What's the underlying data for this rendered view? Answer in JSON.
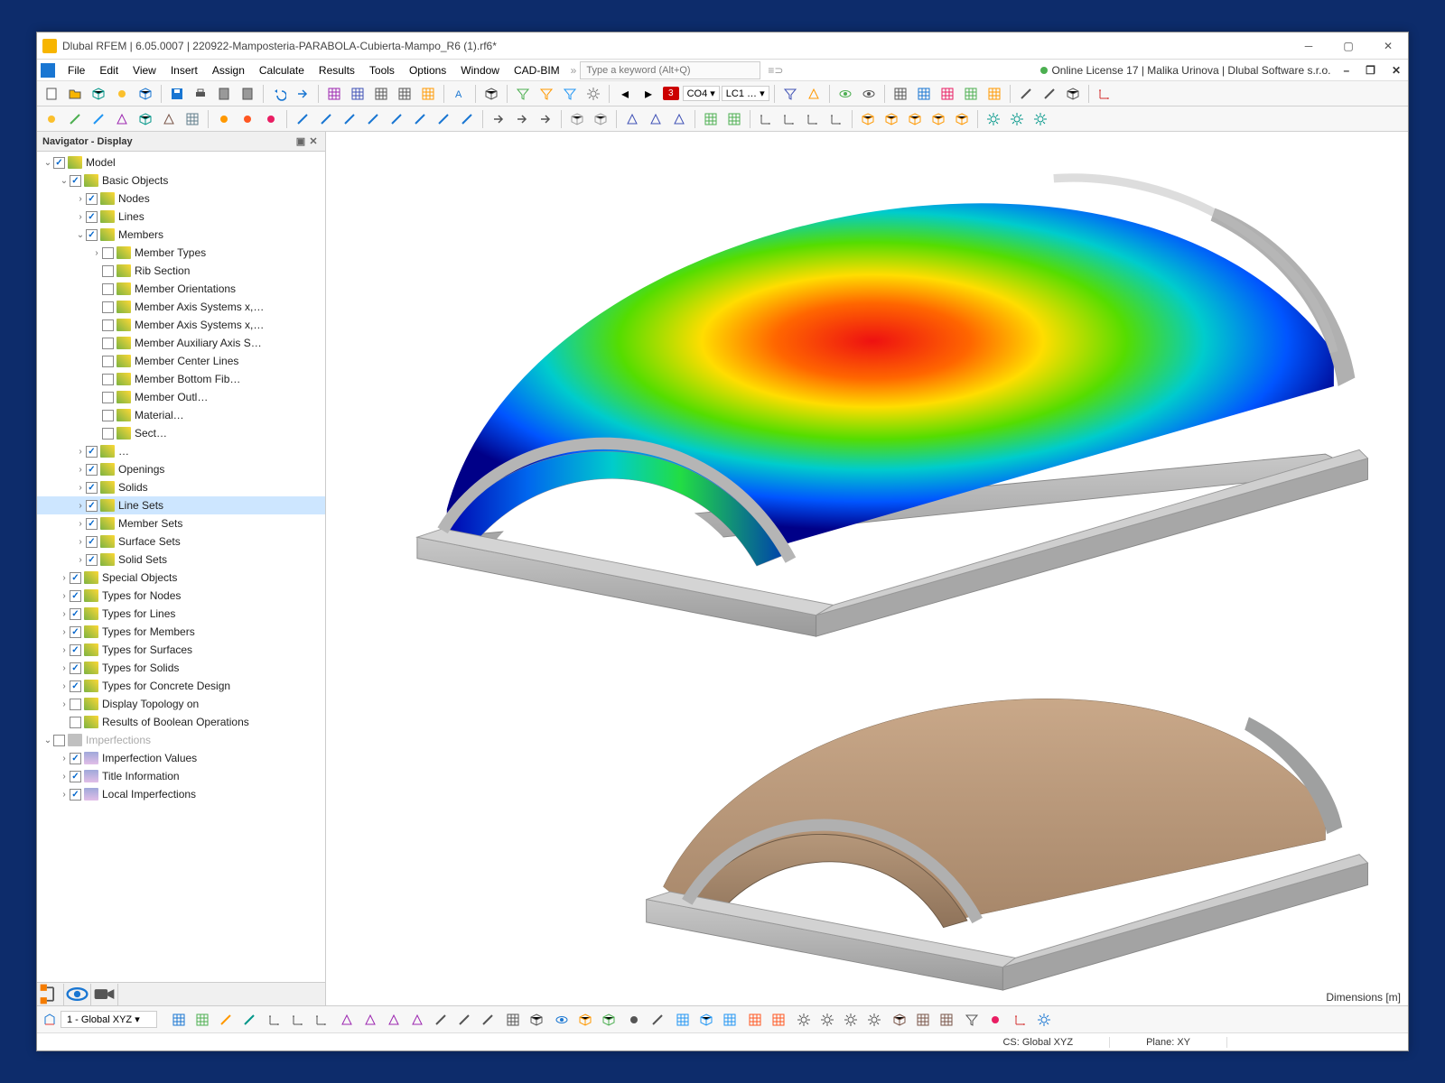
{
  "window": {
    "title": "Dlubal RFEM | 6.05.0007 | 220922-Mamposteria-PARABOLA-Cubierta-Mampo_R6 (1).rf6*"
  },
  "menu": {
    "items": [
      "File",
      "Edit",
      "View",
      "Insert",
      "Assign",
      "Calculate",
      "Results",
      "Tools",
      "Options",
      "Window",
      "CAD-BIM"
    ],
    "more": "»",
    "search_placeholder": "Type a keyword (Alt+Q)",
    "license": "Online License 17 | Malika Urinova | Dlubal Software s.r.o."
  },
  "toolbar_top": {
    "co_number": "3",
    "co_label": "CO4",
    "lc_label": "LC1 …",
    "dd": "▾"
  },
  "navigator": {
    "title": "Navigator - Display",
    "tabs_icons": [
      "tree",
      "eye",
      "camera"
    ],
    "rows": [
      {
        "d": 0,
        "tw": "v",
        "chk": true,
        "label": "Model"
      },
      {
        "d": 1,
        "tw": "v",
        "chk": true,
        "label": "Basic Objects"
      },
      {
        "d": 2,
        "tw": ">",
        "chk": true,
        "label": "Nodes"
      },
      {
        "d": 2,
        "tw": ">",
        "chk": true,
        "label": "Lines"
      },
      {
        "d": 2,
        "tw": "v",
        "chk": true,
        "label": "Members"
      },
      {
        "d": 3,
        "tw": ">",
        "chk": false,
        "label": "Member Types"
      },
      {
        "d": 3,
        "tw": "",
        "chk": false,
        "label": "Rib Section"
      },
      {
        "d": 3,
        "tw": "",
        "chk": false,
        "label": "Member Orientations"
      },
      {
        "d": 3,
        "tw": "",
        "chk": false,
        "label": "Member Axis Systems x,…"
      },
      {
        "d": 3,
        "tw": "",
        "chk": false,
        "label": "Member Axis Systems x,…"
      },
      {
        "d": 3,
        "tw": "",
        "chk": false,
        "label": "Member Auxiliary Axis S…"
      },
      {
        "d": 3,
        "tw": "",
        "chk": false,
        "label": "Member Center Lines"
      },
      {
        "d": 3,
        "tw": "",
        "chk": false,
        "label": "Member Bottom Fib…"
      },
      {
        "d": 3,
        "tw": "",
        "chk": false,
        "label": "Member Outl…"
      },
      {
        "d": 3,
        "tw": "",
        "chk": false,
        "label": "Material…"
      },
      {
        "d": 3,
        "tw": "",
        "chk": false,
        "label": "Sect…"
      },
      {
        "d": 2,
        "tw": ">",
        "chk": true,
        "label": "…"
      },
      {
        "d": 2,
        "tw": ">",
        "chk": true,
        "label": "Openings"
      },
      {
        "d": 2,
        "tw": ">",
        "chk": true,
        "label": "Solids"
      },
      {
        "d": 2,
        "tw": ">",
        "chk": true,
        "label": "Line Sets",
        "selected": true
      },
      {
        "d": 2,
        "tw": ">",
        "chk": true,
        "label": "Member Sets"
      },
      {
        "d": 2,
        "tw": ">",
        "chk": true,
        "label": "Surface Sets"
      },
      {
        "d": 2,
        "tw": ">",
        "chk": true,
        "label": "Solid Sets"
      },
      {
        "d": 1,
        "tw": ">",
        "chk": true,
        "label": "Special Objects"
      },
      {
        "d": 1,
        "tw": ">",
        "chk": true,
        "label": "Types for Nodes"
      },
      {
        "d": 1,
        "tw": ">",
        "chk": true,
        "label": "Types for Lines"
      },
      {
        "d": 1,
        "tw": ">",
        "chk": true,
        "label": "Types for Members"
      },
      {
        "d": 1,
        "tw": ">",
        "chk": true,
        "label": "Types for Surfaces"
      },
      {
        "d": 1,
        "tw": ">",
        "chk": true,
        "label": "Types for Solids"
      },
      {
        "d": 1,
        "tw": ">",
        "chk": true,
        "label": "Types for Concrete Design"
      },
      {
        "d": 1,
        "tw": ">",
        "chk": false,
        "label": "Display Topology on"
      },
      {
        "d": 1,
        "tw": "",
        "chk": false,
        "label": "Results of Boolean Operations"
      },
      {
        "d": 0,
        "tw": "v",
        "chk": false,
        "iconClass": "grey",
        "label": "Imperfections",
        "disabled": true
      },
      {
        "d": 1,
        "tw": ">",
        "chk": true,
        "iconClass": "imp",
        "label": "Imperfection Values"
      },
      {
        "d": 1,
        "tw": ">",
        "chk": true,
        "iconClass": "imp",
        "label": "Title Information"
      },
      {
        "d": 1,
        "tw": ">",
        "chk": true,
        "iconClass": "imp",
        "label": "Local Imperfections"
      }
    ]
  },
  "viewport": {
    "dimensions_label": "Dimensions [m]"
  },
  "statusbar": {
    "coord_system": "1 - Global XYZ",
    "cs": "CS: Global XYZ",
    "plane": "Plane: XY"
  }
}
